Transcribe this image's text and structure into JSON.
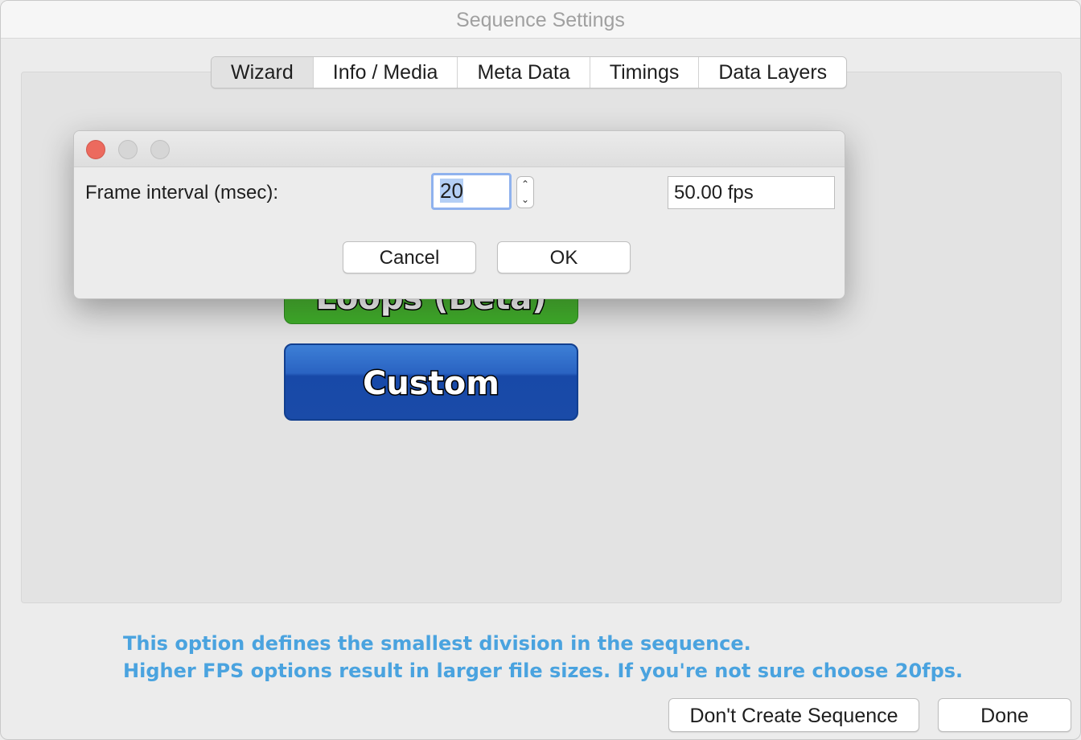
{
  "window": {
    "title": "Sequence Settings"
  },
  "tabs": [
    {
      "label": "Wizard",
      "active": true
    },
    {
      "label": "Info / Media",
      "active": false
    },
    {
      "label": "Meta Data",
      "active": false
    },
    {
      "label": "Timings",
      "active": false
    },
    {
      "label": "Data Layers",
      "active": false
    }
  ],
  "wizard": {
    "partial_button_label": "Loops (Beta)",
    "custom_button_label": "Custom"
  },
  "dialog": {
    "frame_interval_label": "Frame interval (msec):",
    "frame_interval_value": "20",
    "fps_value": "50.00 fps",
    "cancel_label": "Cancel",
    "ok_label": "OK"
  },
  "help": {
    "line1": "This option defines the smallest division in the sequence.",
    "line2": "Higher FPS options result in larger file sizes.  If you're not sure choose 20fps."
  },
  "footer": {
    "dont_create_label": "Don't Create Sequence",
    "done_label": "Done"
  },
  "colors": {
    "help_text": "#4aa3df",
    "close_button": "#ec6a5e",
    "custom_button": "#1a4ba8",
    "loops_button": "#3fae2a"
  }
}
